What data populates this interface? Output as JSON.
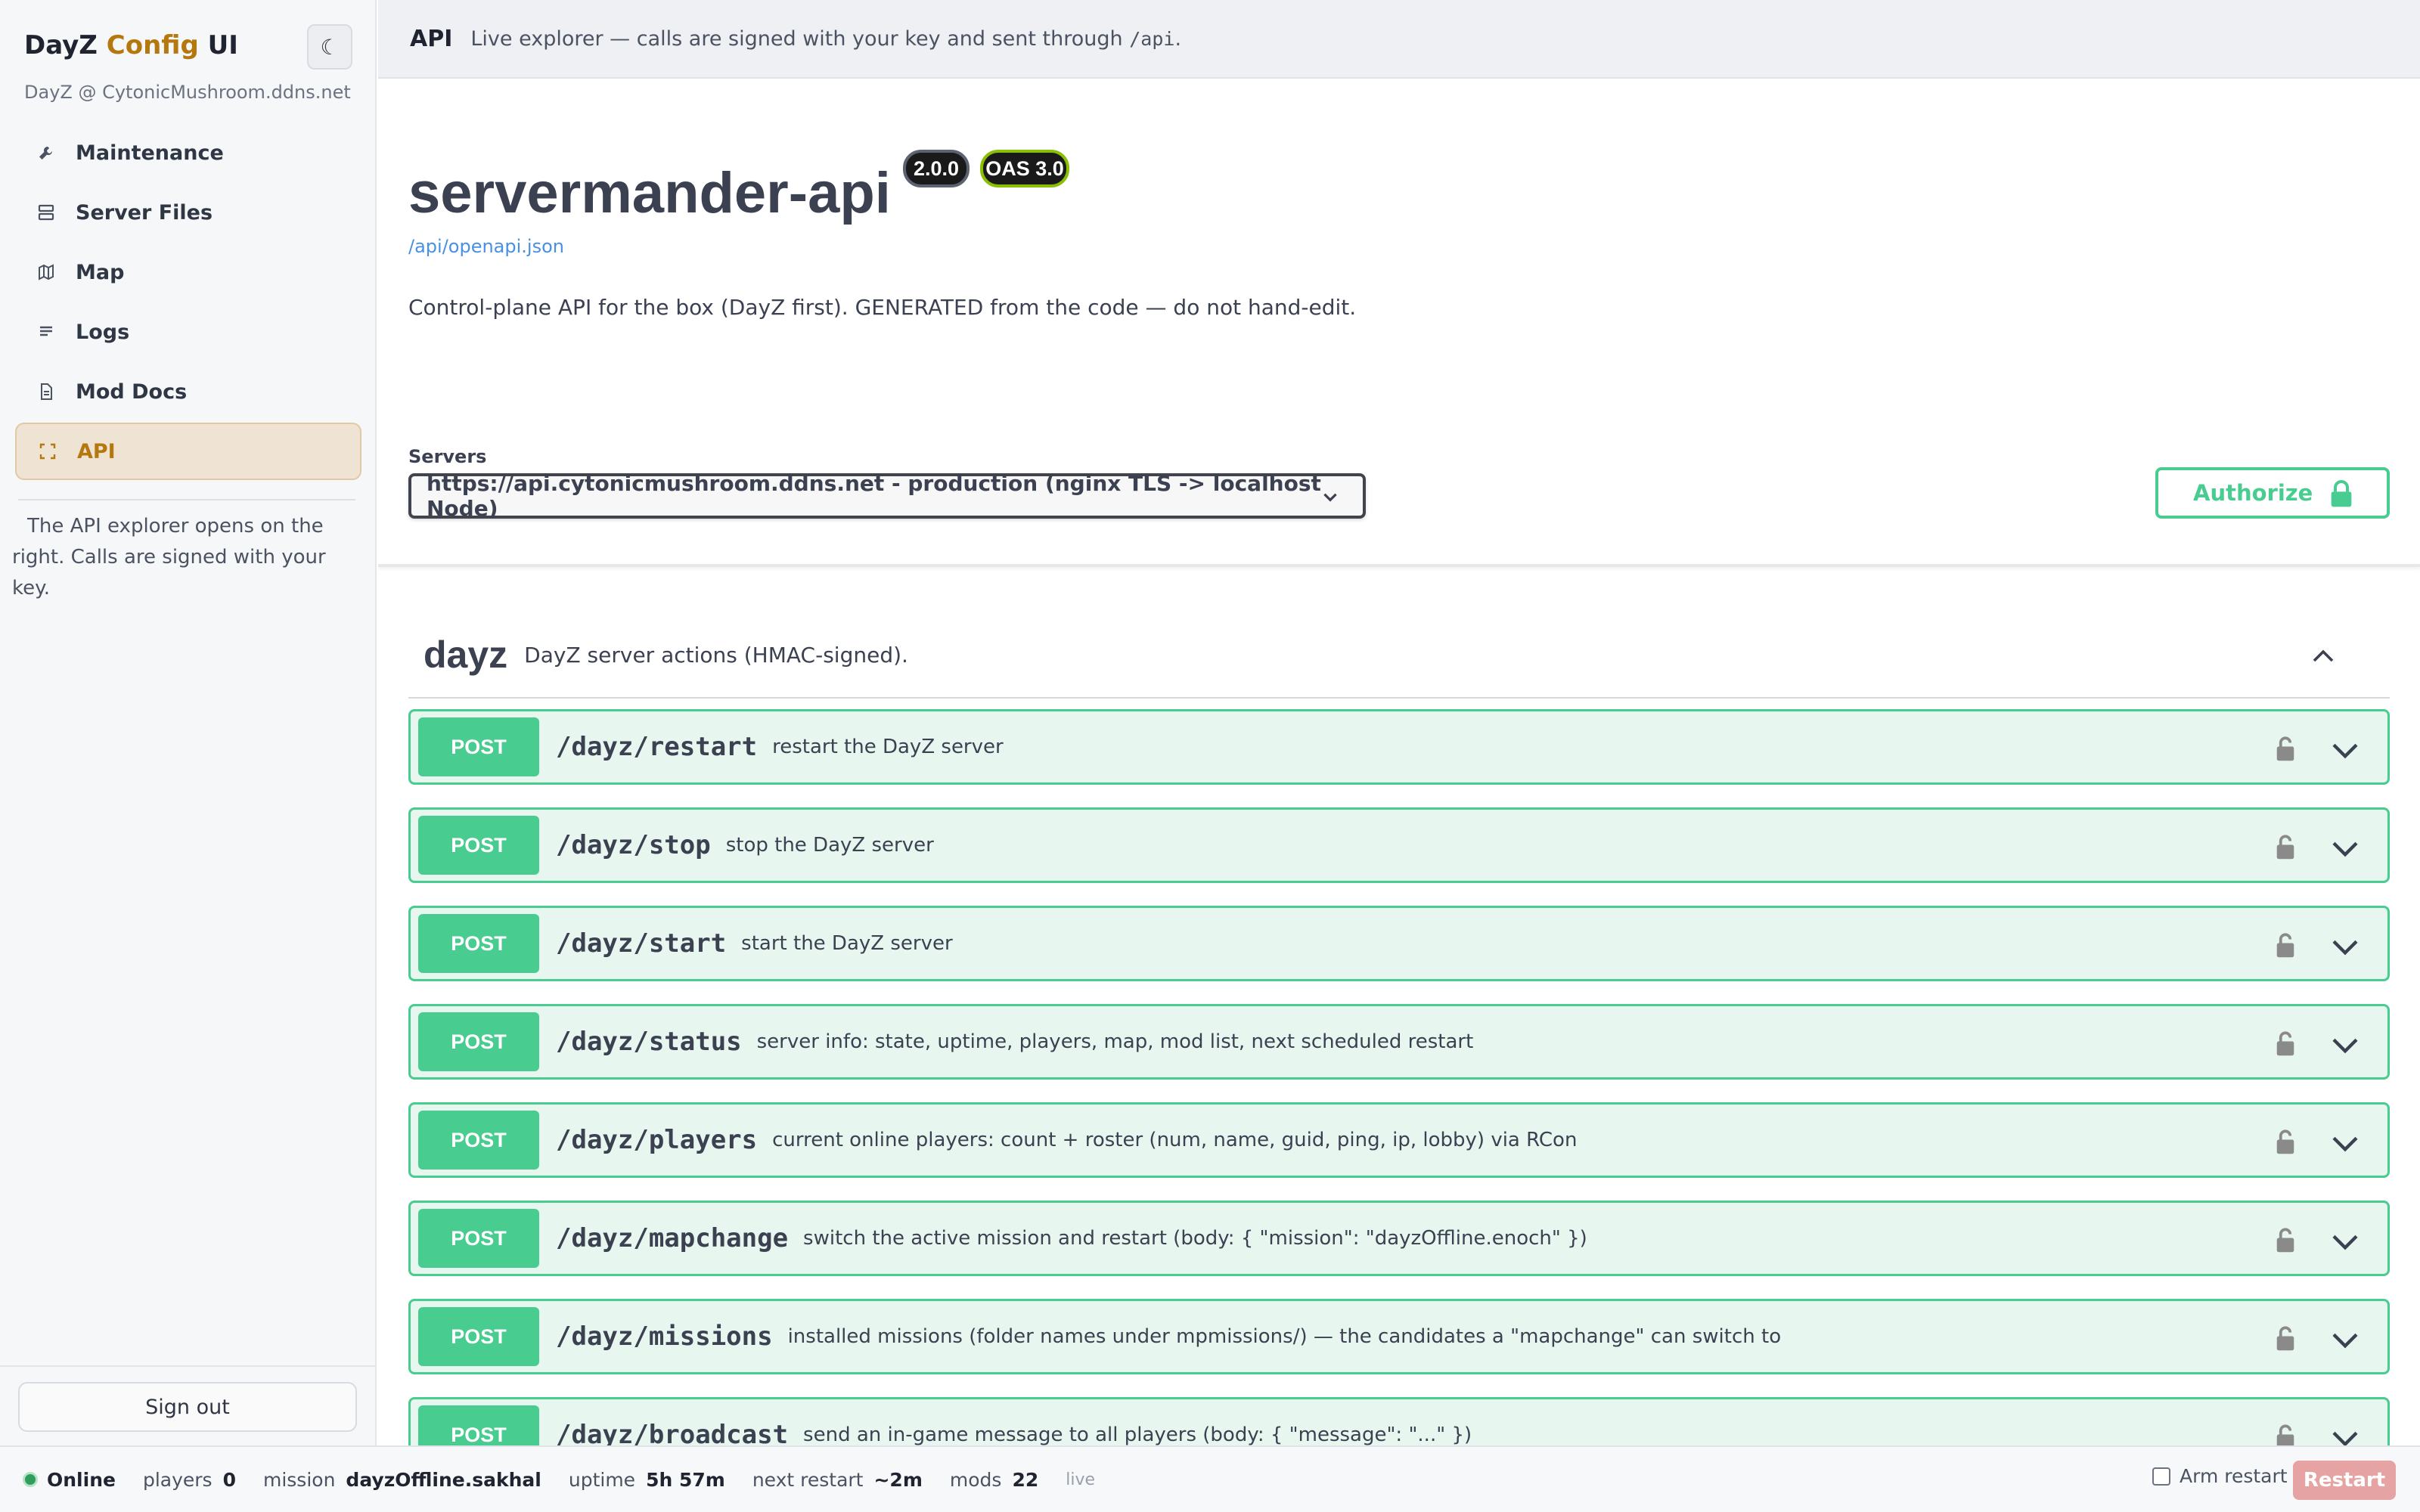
{
  "sidebar": {
    "brand": {
      "part1": "DayZ ",
      "part2": "Config",
      "part3": " UI"
    },
    "theme_toggle_glyph": "☾",
    "host": "DayZ @ CytonicMushroom.ddns.net",
    "items": [
      {
        "label": "Maintenance",
        "icon": "wrench-icon"
      },
      {
        "label": "Server Files",
        "icon": "server-icon"
      },
      {
        "label": "Map",
        "icon": "map-icon"
      },
      {
        "label": "Logs",
        "icon": "list-icon"
      },
      {
        "label": "Mod Docs",
        "icon": "document-icon"
      },
      {
        "label": "API",
        "icon": "expand-icon",
        "active": true
      }
    ],
    "hint": "The API explorer opens on the right. Calls are signed with your key.",
    "signout_label": "Sign out"
  },
  "topbar": {
    "title": "API",
    "desc_prefix": "Live explorer — calls are signed with your key and sent through ",
    "desc_code": "/api",
    "desc_suffix": "."
  },
  "swagger": {
    "title": "servermander-api",
    "version": "2.0.0",
    "oas": "OAS 3.0",
    "spec_link": "/api/openapi.json",
    "description": "Control-plane API for the box (DayZ first). GENERATED from the code — do not hand-edit.",
    "servers_label": "Servers",
    "server_selected": "https://api.cytonicmushroom.ddns.net - production (nginx TLS -> localhost Node)",
    "authorize_label": "Authorize",
    "tag": {
      "name": "dayz",
      "description": "DayZ server actions (HMAC-signed)."
    },
    "operations": [
      {
        "method": "POST",
        "path": "/dayz/restart",
        "summary": "restart the DayZ server"
      },
      {
        "method": "POST",
        "path": "/dayz/stop",
        "summary": "stop the DayZ server"
      },
      {
        "method": "POST",
        "path": "/dayz/start",
        "summary": "start the DayZ server"
      },
      {
        "method": "POST",
        "path": "/dayz/status",
        "summary": "server info: state, uptime, players, map, mod list, next scheduled restart"
      },
      {
        "method": "POST",
        "path": "/dayz/players",
        "summary": "current online players: count + roster (num, name, guid, ping, ip, lobby) via RCon"
      },
      {
        "method": "POST",
        "path": "/dayz/mapchange",
        "summary": "switch the active mission and restart (body: { \"mission\": \"dayzOffline.enoch\" })"
      },
      {
        "method": "POST",
        "path": "/dayz/missions",
        "summary": "installed missions (folder names under mpmissions/) — the candidates a \"mapchange\" can switch to"
      },
      {
        "method": "POST",
        "path": "/dayz/broadcast",
        "summary": "send an in-game message to all players (body: { \"message\": \"...\" })"
      }
    ]
  },
  "statusbar": {
    "state": "Online",
    "players_label": "players",
    "players_value": "0",
    "mission_label": "mission",
    "mission_value": "dayzOffline.sakhal",
    "uptime_label": "uptime",
    "uptime_value": "5h 57m",
    "next_restart_label": "next restart",
    "next_restart_value": "~2m",
    "mods_label": "mods",
    "mods_value": "22",
    "live_label": "live",
    "arm_restart_label": "Arm restart",
    "restart_label": "Restart"
  },
  "colors": {
    "accent": "#b4780f",
    "post": "#49cc90",
    "post_bg": "#e8f6f0",
    "online": "#2f9e5a",
    "restart": "#e6a3a3"
  }
}
